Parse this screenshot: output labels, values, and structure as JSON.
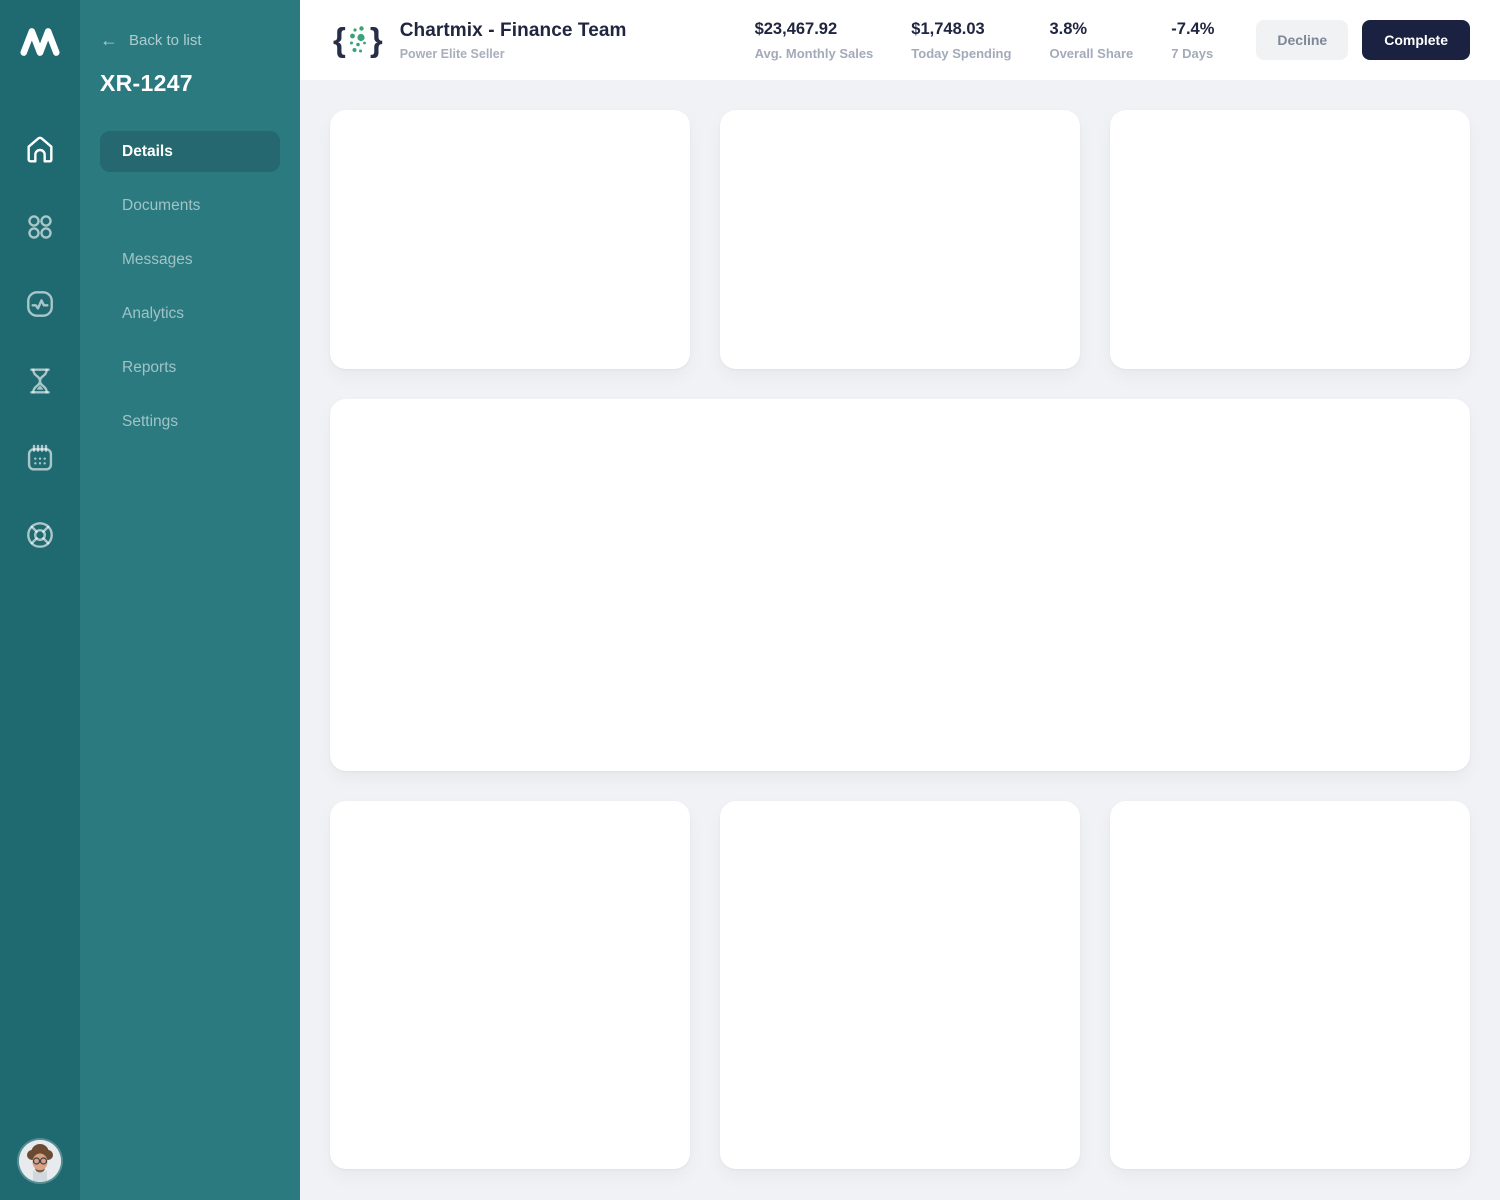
{
  "brand": {
    "name": "M mark"
  },
  "sidebar": {
    "back_label": "Back to list",
    "record_id": "XR-1247",
    "items": [
      {
        "label": "Details",
        "active": true
      },
      {
        "label": "Documents",
        "active": false
      },
      {
        "label": "Messages",
        "active": false
      },
      {
        "label": "Analytics",
        "active": false
      },
      {
        "label": "Reports",
        "active": false
      },
      {
        "label": "Settings",
        "active": false
      }
    ],
    "rail_icons": [
      "home-icon",
      "apps-grid-icon",
      "activity-icon",
      "hourglass-icon",
      "calendar-icon",
      "life-buoy-icon"
    ]
  },
  "header": {
    "logo_braces": {
      "open": "{",
      "close": "}"
    },
    "title": "Chartmix - Finance Team",
    "subtitle": "Power Elite Seller",
    "stats": [
      {
        "value": "$23,467.92",
        "label": "Avg. Monthly Sales"
      },
      {
        "value": "$1,748.03",
        "label": "Today Spending"
      },
      {
        "value": "3.8%",
        "label": "Overall Share"
      },
      {
        "value": "-7.4%",
        "label": "7 Days"
      }
    ],
    "decline_label": "Decline",
    "complete_label": "Complete"
  },
  "colors": {
    "rail_bg": "#1f6970",
    "sidebar_bg": "#2a7a80",
    "sidebar_active_bg": "#25686f",
    "accent_green": "#37a376",
    "navy": "#1b2140",
    "content_bg": "#f1f2f5"
  }
}
